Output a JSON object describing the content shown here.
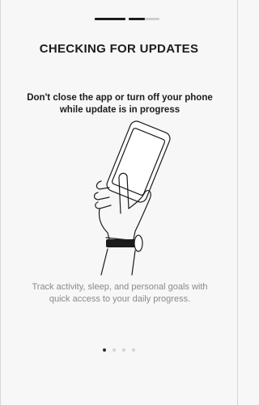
{
  "header": {
    "progress_steps": 3,
    "progress_completed": 2
  },
  "title": "CHECKING FOR UPDATES",
  "warning": "Don't close the app or turn off your phone while update is in progress",
  "illustration": {
    "icon": "hand-holding-phone-icon"
  },
  "description": "Track activity, sleep, and personal goals with quick access to your daily progress.",
  "pager": {
    "page_count": 4,
    "current_page": 1
  }
}
